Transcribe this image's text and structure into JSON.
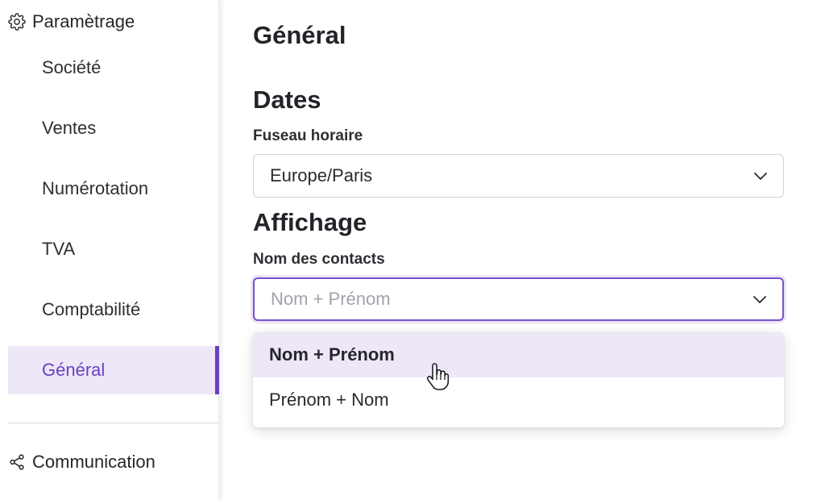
{
  "sidebar": {
    "settings_header": "Paramètrage",
    "items": [
      {
        "label": "Société"
      },
      {
        "label": "Ventes"
      },
      {
        "label": "Numérotation"
      },
      {
        "label": "TVA"
      },
      {
        "label": "Comptabilité"
      },
      {
        "label": "Général",
        "active": true
      }
    ],
    "communication_header": "Communication"
  },
  "main": {
    "title": "Général",
    "dates": {
      "section_title": "Dates",
      "timezone_label": "Fuseau horaire",
      "timezone_value": "Europe/Paris"
    },
    "display": {
      "section_title": "Affichage",
      "contact_name_label": "Nom des contacts",
      "contact_name_placeholder": "Nom + Prénom",
      "options": [
        {
          "label": "Nom + Prénom",
          "hovered": true
        },
        {
          "label": "Prénom + Nom"
        }
      ]
    }
  },
  "colors": {
    "accent": "#6a3fc1",
    "active_bg": "#ede7f7"
  },
  "icons": {
    "settings": "gear-icon",
    "communication": "share-icon",
    "select_arrow": "chevron-down-icon",
    "cursor": "hand-pointer-icon"
  }
}
